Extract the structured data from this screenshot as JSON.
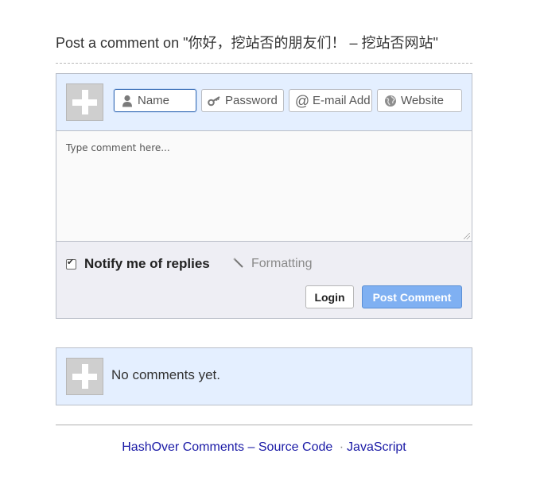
{
  "header": {
    "title": "Post a comment on \"你好，挖站否的朋友们！ – 挖站否网站\""
  },
  "form": {
    "name_placeholder": "Name",
    "password_placeholder": "Password",
    "email_placeholder": "E-mail Address",
    "website_placeholder": "Website",
    "comment_placeholder": "Type comment here...",
    "notify_label": "Notify me of replies",
    "notify_checked": true,
    "formatting_label": "Formatting",
    "login_label": "Login",
    "post_label": "Post Comment"
  },
  "comments": {
    "empty_text": "No comments yet."
  },
  "footer": {
    "brand": "HashOver Comments",
    "dash": "–",
    "source_label": "Source Code",
    "sep": "·",
    "js_label": "JavaScript"
  },
  "colors": {
    "header_bg": "#e4efff",
    "post_button": "#7fb0f2",
    "link": "#1a1aa6"
  }
}
